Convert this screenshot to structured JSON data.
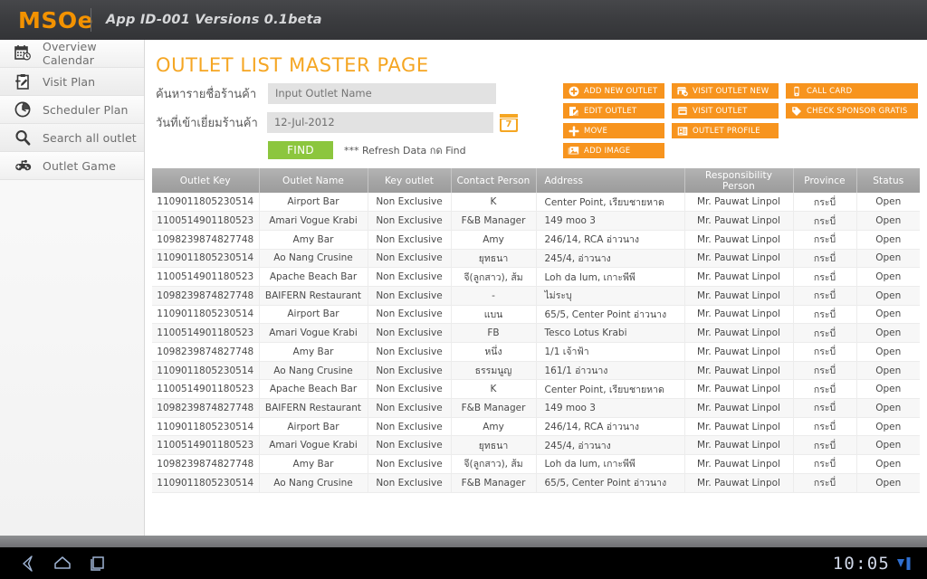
{
  "header": {
    "brand": "MSOe",
    "app_version": "App ID-001 Versions 0.1beta"
  },
  "sidebar": {
    "items": [
      {
        "label": "Overview Calendar",
        "icon": "calendar-clock-icon"
      },
      {
        "label": "Visit Plan",
        "icon": "clipboard-pen-icon"
      },
      {
        "label": "Scheduler Plan",
        "icon": "clock-icon"
      },
      {
        "label": "Search all outlet",
        "icon": "magnifier-icon"
      },
      {
        "label": "Outlet Game",
        "icon": "gamepad-icon"
      }
    ]
  },
  "main": {
    "page_title": "OUTLET LIST MASTER PAGE",
    "form": {
      "outlet_name_label": "ค้นหารายชื่อร้านค้า",
      "outlet_name_placeholder": "Input Outlet Name",
      "outlet_name_value": "",
      "visit_date_label": "วันที่เข้าเยี่ยมร้านค้า",
      "visit_date_value": "12-Jul-2012",
      "calendar_day": "7",
      "find_label": "FIND",
      "refresh_note": "*** Refresh Data กด Find"
    },
    "actions": {
      "col1": [
        {
          "label": "ADD NEW OUTLET",
          "icon": "plus-circle-icon"
        },
        {
          "label": "EDIT OUTLET",
          "icon": "edit-document-icon"
        },
        {
          "label": "MOVE",
          "icon": "move-cross-icon"
        },
        {
          "label": "ADD IMAGE",
          "icon": "image-icon"
        }
      ],
      "col2": [
        {
          "label": "VISIT OUTLET NEW",
          "icon": "store-plus-icon"
        },
        {
          "label": "VISIT OUTLET",
          "icon": "store-icon"
        },
        {
          "label": "OUTLET PROFILE",
          "icon": "id-card-icon"
        }
      ],
      "col3": [
        {
          "label": "CALL CARD",
          "icon": "phone-icon"
        },
        {
          "label": "CHECK SPONSOR GRATIS",
          "icon": "tag-icon"
        }
      ]
    },
    "table": {
      "columns": [
        "Outlet Key",
        "Outlet Name",
        "Key outlet",
        "Contact Person",
        "Address",
        "Responsibility Person",
        "Province",
        "Status"
      ],
      "rows": [
        [
          "1109011805230514",
          "Airport Bar",
          "Non Exclusive",
          "K",
          "Center Point, เรียบชายหาด",
          "Mr. Pauwat Linpol",
          "กระบี่",
          "Open"
        ],
        [
          "1100514901180523",
          "Amari Vogue Krabi",
          "Non Exclusive",
          "F&B Manager",
          "149 moo 3",
          "Mr. Pauwat Linpol",
          "กระบี่",
          "Open"
        ],
        [
          "1098239874827748",
          "Amy Bar",
          "Non Exclusive",
          "Amy",
          "246/14, RCA อ่าวนาง",
          "Mr. Pauwat Linpol",
          "กระบี่",
          "Open"
        ],
        [
          "1109011805230514",
          "Ao Nang Crusine",
          "Non Exclusive",
          "ยุทธนา",
          "245/4, อ่าวนาง",
          "Mr. Pauwat Linpol",
          "กระบี่",
          "Open"
        ],
        [
          "1100514901180523",
          "Apache Beach Bar",
          "Non Exclusive",
          "จี(ลูกสาว), ส้ม",
          "Loh da lum, เกาะพีพี",
          "Mr. Pauwat Linpol",
          "กระบี่",
          "Open"
        ],
        [
          "1098239874827748",
          "BAIFERN Restaurant",
          "Non Exclusive",
          "-",
          "ไม่ระบุ",
          "Mr. Pauwat Linpol",
          "กระบี่",
          "Open"
        ],
        [
          "1109011805230514",
          "Airport Bar",
          "Non Exclusive",
          "แบน",
          "65/5, Center Point อ่าวนาง",
          "Mr. Pauwat Linpol",
          "กระบี่",
          "Open"
        ],
        [
          "1100514901180523",
          "Amari Vogue Krabi",
          "Non Exclusive",
          "FB",
          "Tesco Lotus Krabi",
          "Mr. Pauwat Linpol",
          "กระบี่",
          "Open"
        ],
        [
          "1098239874827748",
          "Amy Bar",
          "Non Exclusive",
          "หนึ่ง",
          "1/1 เจ้าฟ้า",
          "Mr. Pauwat Linpol",
          "กระบี่",
          "Open"
        ],
        [
          "1109011805230514",
          "Ao Nang Crusine",
          "Non Exclusive",
          "ธรรมนูญ",
          "161/1 อ่าวนาง",
          "Mr. Pauwat Linpol",
          "กระบี่",
          "Open"
        ],
        [
          "1100514901180523",
          "Apache Beach Bar",
          "Non Exclusive",
          "K",
          "Center Point, เรียบชายหาด",
          "Mr. Pauwat Linpol",
          "กระบี่",
          "Open"
        ],
        [
          "1098239874827748",
          "BAIFERN Restaurant",
          "Non Exclusive",
          "F&B Manager",
          "149 moo 3",
          "Mr. Pauwat Linpol",
          "กระบี่",
          "Open"
        ],
        [
          "1109011805230514",
          "Airport Bar",
          "Non Exclusive",
          "Amy",
          "246/14, RCA อ่าวนาง",
          "Mr. Pauwat Linpol",
          "กระบี่",
          "Open"
        ],
        [
          "1100514901180523",
          "Amari Vogue Krabi",
          "Non Exclusive",
          "ยุทธนา",
          "245/4, อ่าวนาง",
          "Mr. Pauwat Linpol",
          "กระบี่",
          "Open"
        ],
        [
          "1098239874827748",
          "Amy Bar",
          "Non Exclusive",
          "จี(ลูกสาว), ส้ม",
          "Loh da lum, เกาะพีพี",
          "Mr. Pauwat Linpol",
          "กระบี่",
          "Open"
        ],
        [
          "1109011805230514",
          "Ao Nang Crusine",
          "Non Exclusive",
          "F&B Manager",
          "65/5, Center Point อ่าวนาง",
          "Mr. Pauwat Linpol",
          "กระบี่",
          "Open"
        ]
      ]
    }
  },
  "navbar": {
    "back_icon": "back-arrow-icon",
    "home_icon": "home-icon",
    "recents_icon": "recent-apps-icon",
    "clock": "10:05"
  },
  "colors": {
    "brand_orange": "#f39200",
    "title_orange": "#f5a623",
    "button_orange": "#f7941e",
    "find_green": "#8cc63e",
    "header_dark": "#3b3c3f",
    "table_header_gray": "#a6a6a6"
  }
}
